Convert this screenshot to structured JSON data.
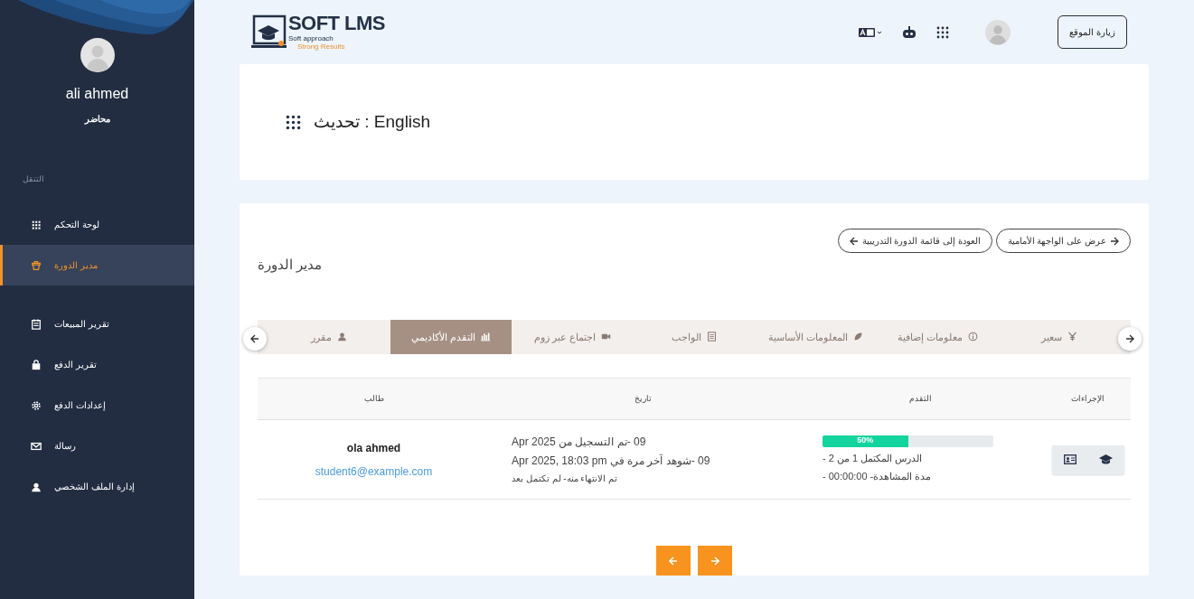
{
  "sidebar": {
    "user_name": "ali ahmed",
    "user_role": "محاضر",
    "section_label": "التنقل",
    "items": [
      {
        "label": "لوحة التحكم",
        "selected": false
      },
      {
        "label": "مدير الدورة",
        "selected": true
      },
      {
        "label": "تقرير المبيعات",
        "selected": false
      },
      {
        "label": "تقرير الدفع",
        "selected": false
      },
      {
        "label": "إعدادات الدفع",
        "selected": false
      },
      {
        "label": "رسالة",
        "selected": false
      },
      {
        "label": "إدارة الملف الشخصي",
        "selected": false
      }
    ]
  },
  "header": {
    "logo": {
      "title": "SOFT LMS",
      "line_1": "Soft approach",
      "line_2": "Strong Results"
    },
    "visit_button": "زيارة الموقع"
  },
  "page_title": "تحديث : English",
  "course_manager": {
    "title": "مدير الدورة",
    "buttons": [
      {
        "label": "عرض على الواجهة الأمامية"
      },
      {
        "label": "العودة إلى قائمة الدورة التدريبية"
      }
    ],
    "tabs": [
      {
        "label": "سعير",
        "selected": false
      },
      {
        "label": "معلومات إضافية",
        "selected": false
      },
      {
        "label": "المعلومات الأساسية",
        "selected": false
      },
      {
        "label": "الواجب",
        "selected": false
      },
      {
        "label": "اجتماع عبر زوم",
        "selected": false
      },
      {
        "label": "التقدم الأكاديمي",
        "selected": true
      },
      {
        "label": "مقرر",
        "selected": false
      }
    ],
    "table": {
      "columns": [
        "الإجراءات",
        "التقدم",
        "تاريخ",
        "طالب"
      ],
      "rows": [
        {
          "student_name": "ola ahmed",
          "student_email": "student6@example.com",
          "dates": [
            "09 -تم التسجيل من Apr 2025",
            "09 -شوهد آخر مرة في Apr 2025, 18:03 pm",
            "تم الانتهاء منه- لم تكتمل بعد"
          ],
          "progress_label": "50%",
          "level": 0.5,
          "progress_lines": [
            "الدرس المكتمل 1 من 2 -",
            "مدة المشاهدة- 00:00:00 -"
          ]
        }
      ]
    }
  }
}
